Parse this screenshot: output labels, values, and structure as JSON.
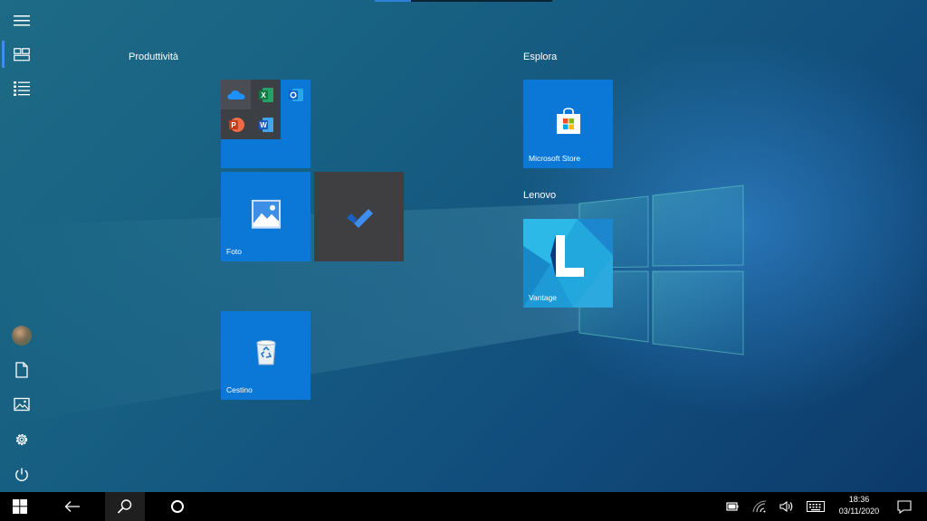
{
  "groups": {
    "productivity_title": "Produttività",
    "explore_title": "Esplora",
    "lenovo_title": "Lenovo"
  },
  "tiles": {
    "foto": "Foto",
    "cestino": "Cestino",
    "store": "Microsoft Store",
    "vantage": "Vantage"
  },
  "folder_apps": [
    "onedrive-icon",
    "excel-icon",
    "outlook-icon",
    "powerpoint-icon",
    "word-icon"
  ],
  "rail": [
    "hamburger-menu-icon",
    "pinned-tiles-icon",
    "all-apps-list-icon",
    "avatar",
    "documents-icon",
    "pictures-icon",
    "settings-icon",
    "power-icon"
  ],
  "taskbar": {
    "time": "18:36",
    "date": "03/11/2020"
  },
  "colors": {
    "accent": "#0b78d8",
    "taskbar": "#000000",
    "folder": "#3c3f44",
    "todo_tile": "#3f3f42"
  }
}
